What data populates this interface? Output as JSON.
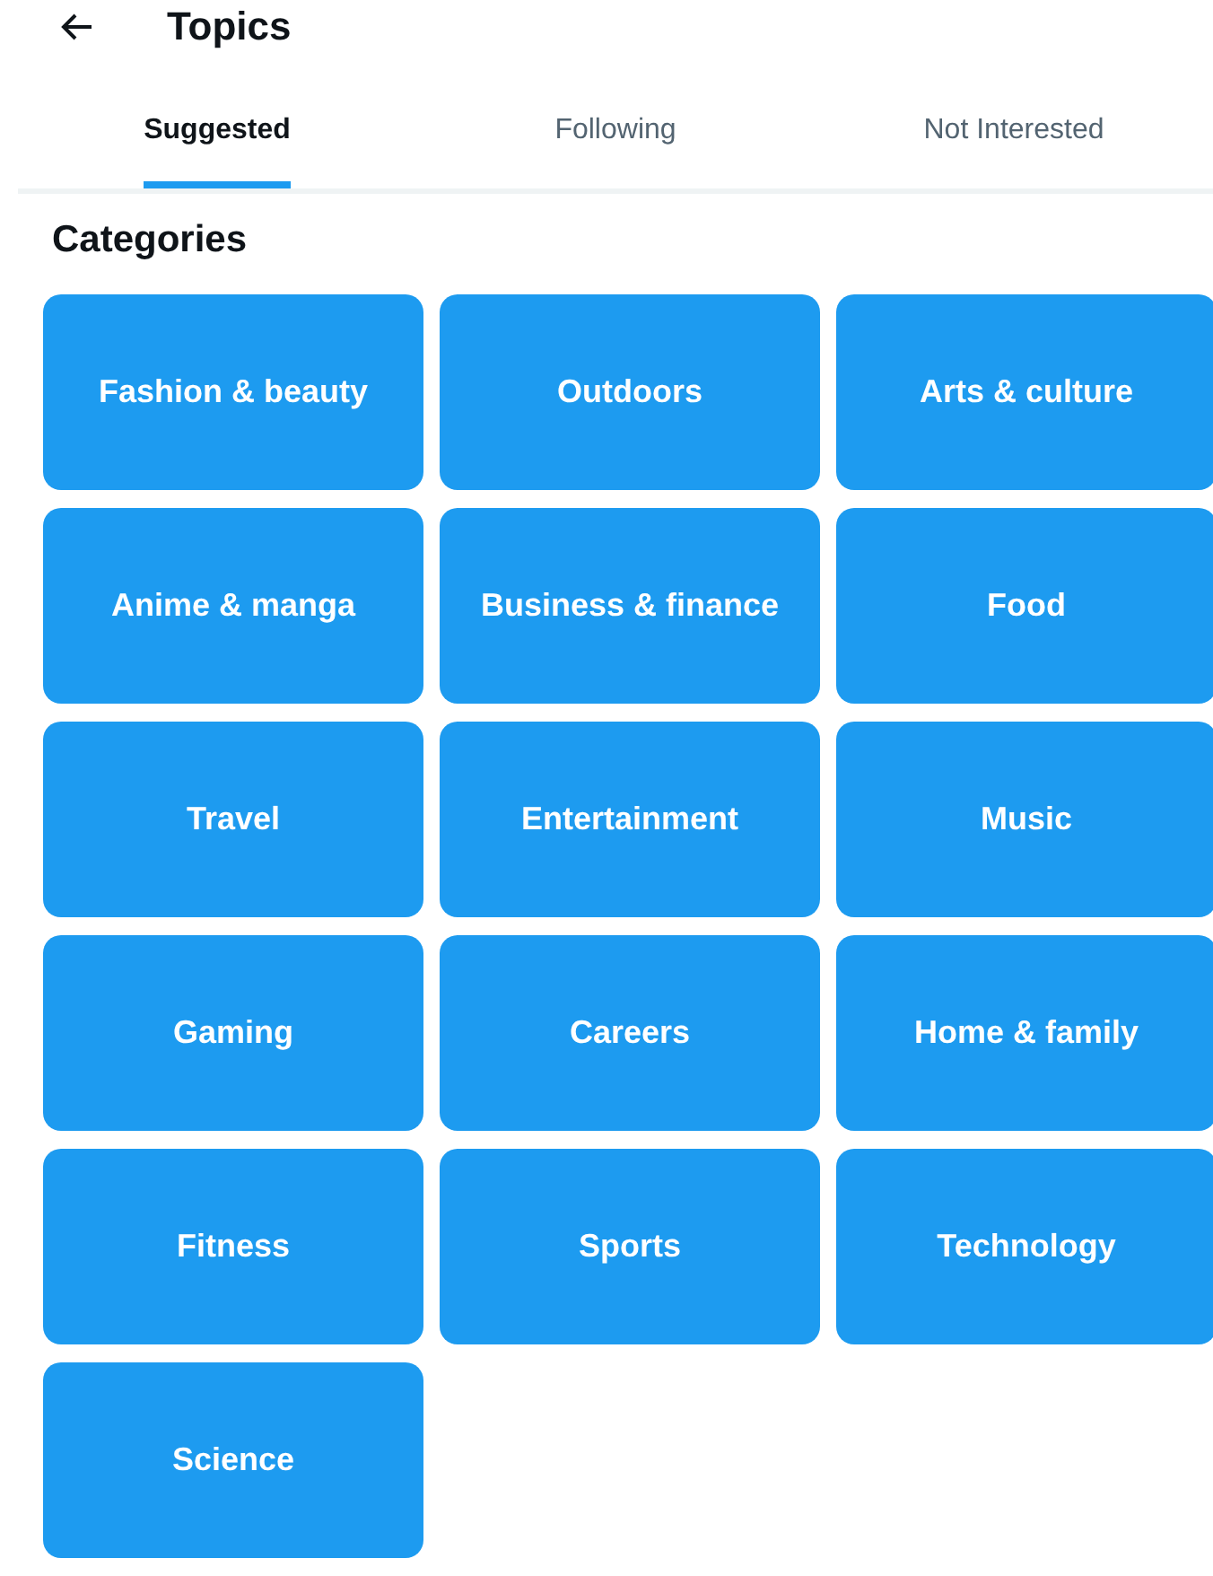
{
  "header": {
    "title": "Topics"
  },
  "tabs": [
    {
      "label": "Suggested",
      "selected": true
    },
    {
      "label": "Following",
      "selected": false
    },
    {
      "label": "Not Interested",
      "selected": false
    }
  ],
  "section": {
    "title": "Categories"
  },
  "categories": [
    {
      "label": "Fashion & beauty"
    },
    {
      "label": "Outdoors"
    },
    {
      "label": "Arts & culture"
    },
    {
      "label": "Anime & manga"
    },
    {
      "label": "Business & finance"
    },
    {
      "label": "Food"
    },
    {
      "label": "Travel"
    },
    {
      "label": "Entertainment"
    },
    {
      "label": "Music"
    },
    {
      "label": "Gaming"
    },
    {
      "label": "Careers"
    },
    {
      "label": "Home & family"
    },
    {
      "label": "Fitness"
    },
    {
      "label": "Sports"
    },
    {
      "label": "Technology"
    },
    {
      "label": "Science"
    }
  ]
}
